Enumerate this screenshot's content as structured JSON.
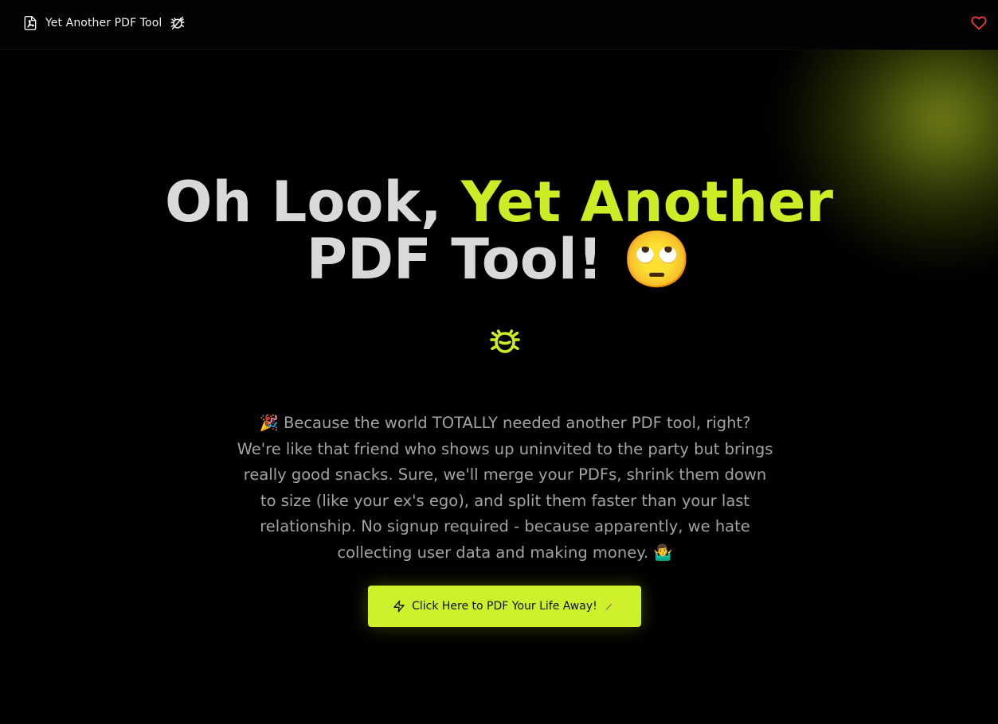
{
  "navbar": {
    "brand_title": "Yet Another PDF Tool"
  },
  "hero": {
    "title_part1": "Oh Look, ",
    "title_accent": "Yet Another",
    "title_part2": "PDF Tool! ",
    "title_emoji": "🙄",
    "description": "🎉 Because the world TOTALLY needed another PDF tool, right? We're like that friend who shows up uninvited to the party but brings really good snacks. Sure, we'll merge your PDFs, shrink them down to size (like your ex's ego), and split them faster than your last relationship. No signup required - because apparently, we hate collecting user data and making money. 🤷‍♂️",
    "cta_label": "Click Here to PDF Your Life Away!",
    "cta_suffix": "🪄"
  },
  "colors": {
    "background": "#000000",
    "accent": "#cdec25",
    "title_text": "#d9d9d9",
    "body_text": "#a3a3a3",
    "heart": "#ff3b3b"
  },
  "icons": {
    "brand_icon": "file-pdf-icon",
    "brand_badge": "bug-icon",
    "favorite": "heart-icon",
    "hero_badge": "bug-icon",
    "cta_icon": "lightning-icon"
  }
}
